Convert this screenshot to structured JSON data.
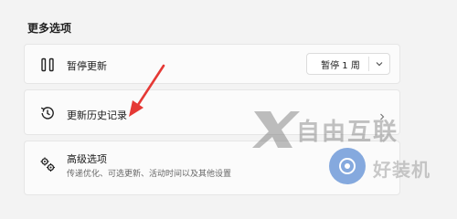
{
  "section": {
    "title": "更多选项"
  },
  "pause": {
    "label": "暂停更新",
    "icon": "pause-icon",
    "select_value": "暂停 1 周",
    "select_icon": "chevron-down-icon"
  },
  "history": {
    "label": "更新历史记录",
    "icon": "history-icon",
    "chevron": "chevron-right-icon"
  },
  "advanced": {
    "label": "高级选项",
    "description": "传递优化、可选更新、活动时间以及其他设置",
    "icon": "gears-icon"
  },
  "watermark": {
    "brand": "自由互联",
    "site": "好装机"
  },
  "colors": {
    "background": "#f3f3f3",
    "card": "#fbfbfb",
    "annotation": "#e53935",
    "watermark_blue": "#5d8dd4"
  }
}
